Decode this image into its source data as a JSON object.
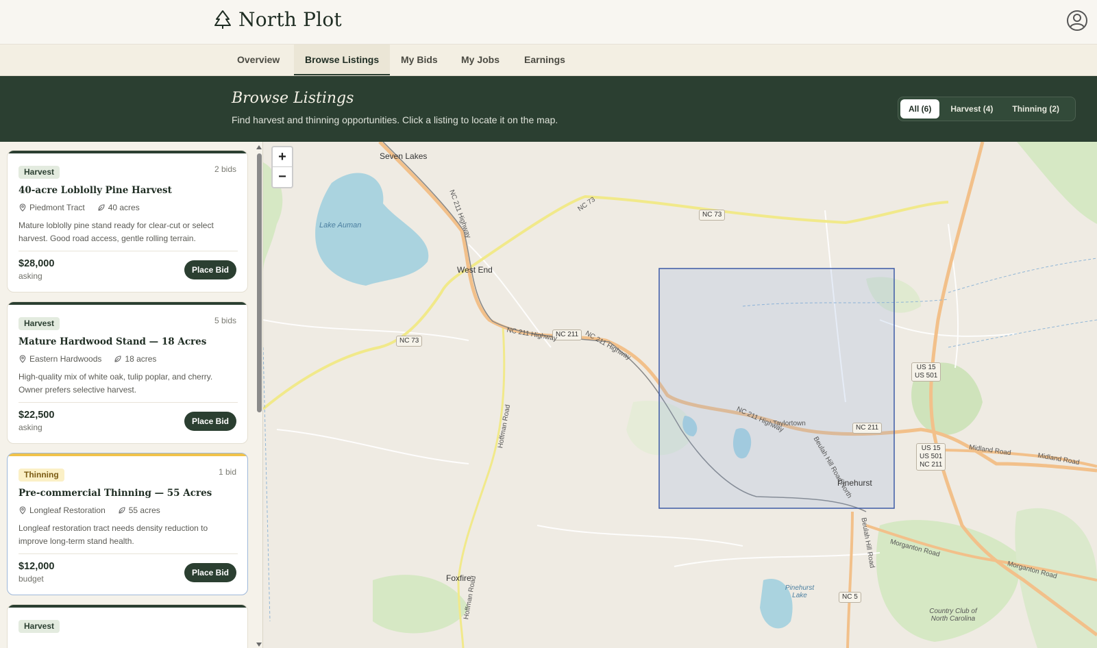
{
  "app": {
    "title": "North Plot"
  },
  "nav": {
    "tabs": [
      "Overview",
      "Browse Listings",
      "My Bids",
      "My Jobs",
      "Earnings"
    ],
    "active": "Browse Listings"
  },
  "hero": {
    "title": "Browse Listings",
    "subtitle": "Find harvest and thinning opportunities. Click a listing to locate it on the map.",
    "filters": [
      "All (6)",
      "Harvest (4)",
      "Thinning (2)"
    ],
    "active_filter": "All (6)"
  },
  "listings": [
    {
      "type": "Harvest",
      "bids": "2 bids",
      "title": "40-acre Loblolly Pine Harvest",
      "location": "Piedmont Tract",
      "acres": "40 acres",
      "description": "Mature loblolly pine stand ready for clear-cut or select harvest. Good road access, gentle rolling terrain.",
      "price": "$28,000",
      "price_note": "asking",
      "action": "Place Bid"
    },
    {
      "type": "Harvest",
      "bids": "5 bids",
      "title": "Mature Hardwood Stand — 18 Acres",
      "location": "Eastern Hardwoods",
      "acres": "18 acres",
      "description": "High-quality mix of white oak, tulip poplar, and cherry. Owner prefers selective harvest.",
      "price": "$22,500",
      "price_note": "asking",
      "action": "Place Bid"
    },
    {
      "type": "Thinning",
      "bids": "1 bid",
      "title": "Pre-commercial Thinning — 55 Acres",
      "location": "Longleaf Restoration",
      "acres": "55 acres",
      "description": "Longleaf restoration tract needs density reduction to improve long-term stand health.",
      "price": "$12,000",
      "price_note": "budget",
      "action": "Place Bid"
    },
    {
      "type": "Harvest"
    }
  ],
  "map": {
    "zoom_in": "+",
    "zoom_out": "−",
    "places": [
      "Seven Lakes",
      "Lake Auman",
      "West End",
      "Taylortown",
      "Pinehurst",
      "Foxfire",
      "Pinehurst Lake",
      "Country Club of North Carolina"
    ],
    "roads": [
      "NC 73",
      "NC 73",
      "NC 73",
      "NC 211",
      "NC 211",
      "NC 211 Highway",
      "NC 211 Highway",
      "NC 211 Highway",
      "NC 211 Highway",
      "Hoffman Road",
      "Hoffman Road",
      "Beulah Hill Road North",
      "Beulah Hill Road",
      "Midland Road",
      "Midland Road",
      "Morganton Road",
      "Morganton Road",
      "NC 5"
    ],
    "shields": [
      "US 15\nUS 501",
      "US 15\nUS 501\nNC 211"
    ]
  }
}
